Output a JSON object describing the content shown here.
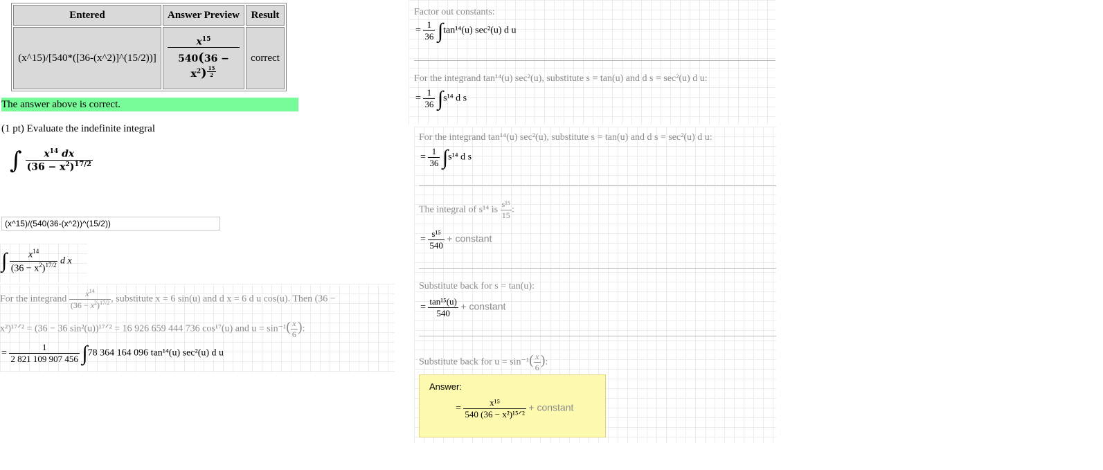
{
  "table": {
    "headers": [
      "Entered",
      "Answer Preview",
      "Result"
    ],
    "entered": "(x^15)/[540*([36-(x^2)]^(15/2))]",
    "preview": {
      "numer": "x",
      "numer_exp": "15",
      "coef": "540",
      "base": "36 − x",
      "base_exp": "2",
      "outer_exp_n": "15",
      "outer_exp_d": "2"
    },
    "result": "correct"
  },
  "status": "The answer above is correct.",
  "problem": {
    "text": "(1 pt) Evaluate the indefinite integral",
    "integral": {
      "numer": "x",
      "numer_exp": "14",
      "dx": "dx",
      "base": "(36 − x",
      "base_exp": "2",
      "outer": "17/2"
    }
  },
  "answer_input": {
    "value": "(x^15)/(540(36-(x^2))^(15/2))"
  },
  "steps_left": {
    "integral_display": {
      "numer": "x",
      "numer_exp": "14",
      "base": "(36 − x",
      "base_exp": "2",
      "outer": "17/2",
      "dx": "d x"
    },
    "sub_line1_a": "For the integrand",
    "sub_line1_b": ", substitute x = 6 sin(u) and d x = 6 d u cos(u). Then (36 −",
    "sub_line2": "x²)¹⁷ᐟ² = (36 − 36 sin²(u))¹⁷ᐟ² = 16 926 659 444 736 cos¹⁷(u) and u = sin⁻¹",
    "sub_frac_n": "x",
    "sub_frac_d": "6",
    "result_numer": "1",
    "result_denom": "2 821 109 907 456",
    "result_integrand": "78 364 164 096 tan¹⁴(u) sec²(u) d u"
  },
  "steps_right": {
    "factor_title": "Factor out constants:",
    "factor_n": "1",
    "factor_d": "36",
    "factor_integrand": "tan¹⁴(u) sec²(u) d u",
    "subs_title": "For the integrand tan¹⁴(u) sec²(u), substitute s = tan(u) and d s = sec²(u) d u:",
    "subs_integrand": "s¹⁴ d s",
    "integral_title_a": "The integral of s¹⁴ is",
    "integral_title_n": "s¹⁵",
    "integral_title_d": "15",
    "result1_n": "s¹⁵",
    "result1_d": "540",
    "constant": "+ constant",
    "back_s_title": "Substitute back for s = tan(u):",
    "result2_n": "tan¹⁵(u)",
    "result2_d": "540",
    "back_u_title": "Substitute back for u = sin⁻¹",
    "answer_label": "Answer:",
    "answer_n": "x¹⁵",
    "answer_d": "540 (36 − x²)¹⁵ᐟ²"
  }
}
